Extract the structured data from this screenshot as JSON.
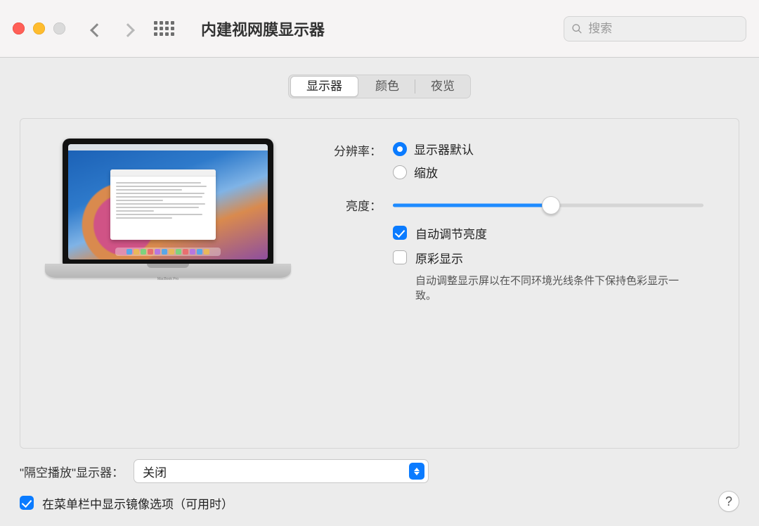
{
  "window": {
    "title": "内建视网膜显示器"
  },
  "search": {
    "placeholder": "搜索"
  },
  "tabs": {
    "display": "显示器",
    "color": "颜色",
    "night": "夜览",
    "active_index": 0
  },
  "form": {
    "resolution_label": "分辨率：",
    "resolution_default": "显示器默认",
    "resolution_scaled": "缩放",
    "resolution_selected": "default",
    "brightness_label": "亮度：",
    "brightness_percent": 51,
    "auto_brightness_label": "自动调节亮度",
    "auto_brightness_checked": true,
    "true_tone_label": "原彩显示",
    "true_tone_checked": false,
    "true_tone_desc": "自动调整显示屏以在不同环境光线条件下保持色彩显示一致。"
  },
  "airplay": {
    "label": "\"隔空播放\"显示器：",
    "value": "关闭"
  },
  "mirror": {
    "label": "在菜单栏中显示镜像选项（可用时）",
    "checked": true
  },
  "help": {
    "label": "?"
  },
  "laptop": {
    "model_text": "MacBook Pro"
  }
}
